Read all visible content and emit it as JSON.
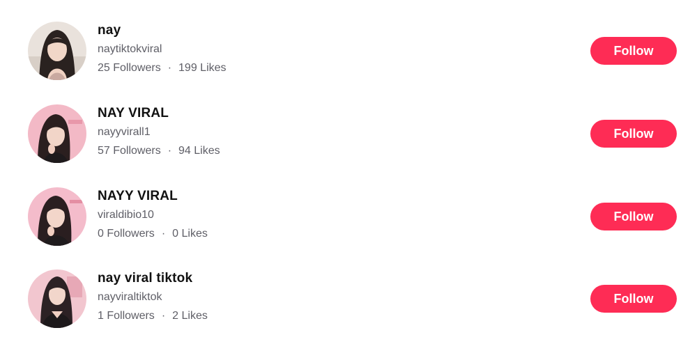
{
  "accent_color": "#fe2c55",
  "users": [
    {
      "nickname": "nay",
      "username": "naytiktokviral",
      "followers": "25 Followers",
      "separator": "·",
      "likes": "199 Likes",
      "follow_label": "Follow",
      "avatar_icon": "user-avatar-photo"
    },
    {
      "nickname": "NAY VIRAL",
      "username": "nayyvirall1",
      "followers": "57 Followers",
      "separator": "·",
      "likes": "94 Likes",
      "follow_label": "Follow",
      "avatar_icon": "user-avatar-photo"
    },
    {
      "nickname": "NAYY VIRAL",
      "username": "viraldibio10",
      "followers": "0 Followers",
      "separator": "·",
      "likes": "0 Likes",
      "follow_label": "Follow",
      "avatar_icon": "user-avatar-photo"
    },
    {
      "nickname": "nay viral tiktok",
      "username": "nayviraltiktok",
      "followers": "1 Followers",
      "separator": "·",
      "likes": "2 Likes",
      "follow_label": "Follow",
      "avatar_icon": "user-avatar-photo"
    }
  ]
}
